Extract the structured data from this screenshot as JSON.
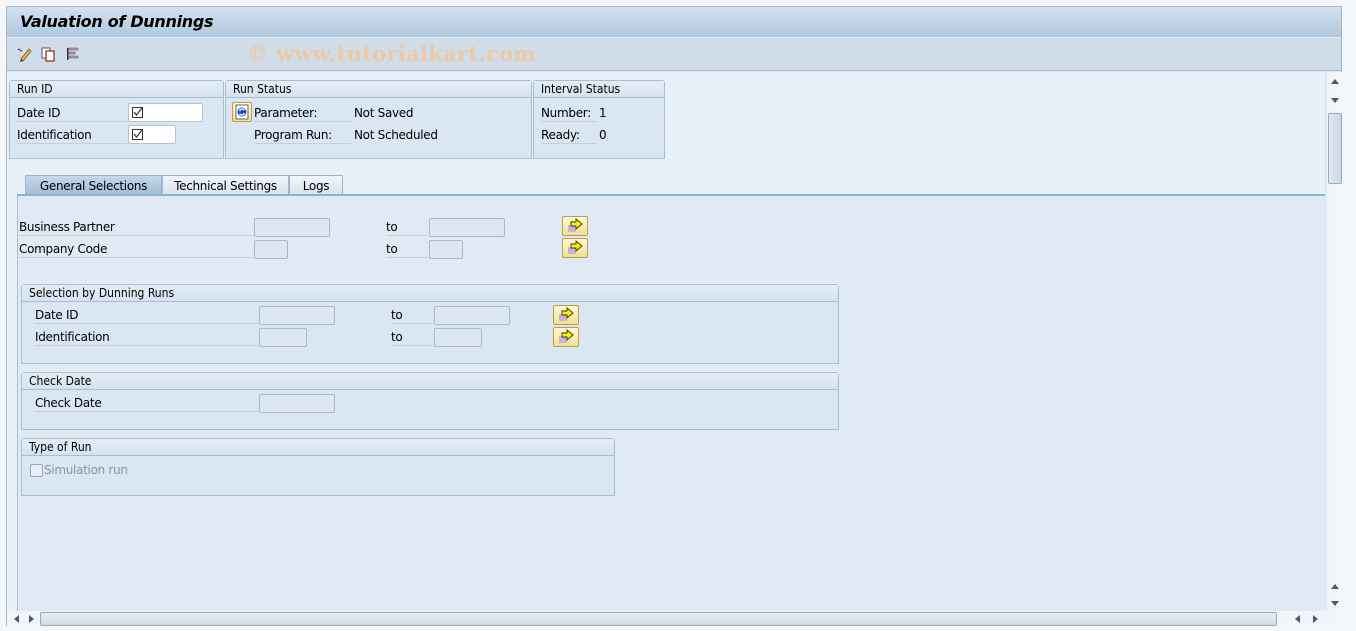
{
  "window": {
    "title": "Valuation of Dunnings",
    "watermark": "© www.tutorialkart.com"
  },
  "toolbar": {
    "icons": [
      {
        "name": "edit-variant-icon",
        "tooltip": ""
      },
      {
        "name": "copy-icon",
        "tooltip": ""
      },
      {
        "name": "log-list-icon",
        "tooltip": ""
      }
    ]
  },
  "run_id": {
    "title": "Run ID",
    "date_id_label": "Date ID",
    "date_id_value": "",
    "date_id_required": true,
    "identification_label": "Identification",
    "identification_value": "",
    "identification_required": true
  },
  "run_status": {
    "title": "Run Status",
    "parameter_label": "Parameter:",
    "parameter_value": "Not Saved",
    "program_run_label": "Program Run:",
    "program_run_value": "Not Scheduled",
    "refresh_icon": "refresh-icon"
  },
  "interval_status": {
    "title": "Interval Status",
    "number_label": "Number:",
    "number_value": "1",
    "ready_label": "Ready:",
    "ready_value": "0"
  },
  "tabs": [
    {
      "label": "General Selections",
      "active": true
    },
    {
      "label": "Technical Settings",
      "active": false
    },
    {
      "label": "Logs",
      "active": false
    }
  ],
  "general_selections": {
    "to_label": "to",
    "business_partner": {
      "label": "Business Partner",
      "from": "",
      "to": ""
    },
    "company_code": {
      "label": "Company Code",
      "from": "",
      "to": ""
    },
    "dunning_runs": {
      "title": "Selection by Dunning Runs",
      "date_id": {
        "label": "Date ID",
        "from": "",
        "to": ""
      },
      "identification": {
        "label": "Identification",
        "from": "",
        "to": ""
      }
    },
    "check_date": {
      "title": "Check Date",
      "label": "Check Date",
      "value": ""
    },
    "type_of_run": {
      "title": "Type of Run",
      "simulation_label": "Simulation run",
      "simulation_checked": false,
      "simulation_enabled": false
    }
  },
  "colors": {
    "title_gradient_top": "#d2e1ee",
    "title_gradient_bottom": "#b2c8de",
    "content_bg": "#dfeaf5",
    "multi_select_button": "#f3e08d",
    "watermark": "#edc9a6"
  }
}
